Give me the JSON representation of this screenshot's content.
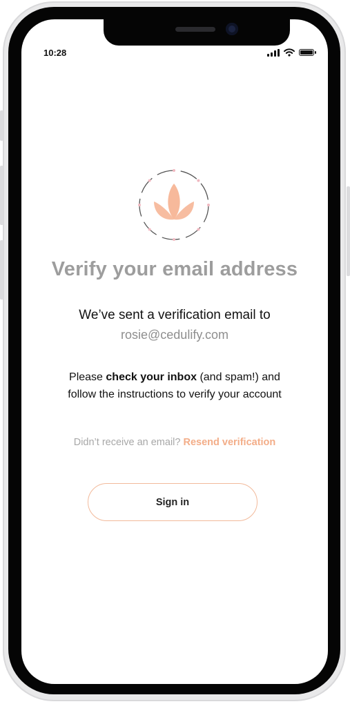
{
  "status_bar": {
    "time": "10:28"
  },
  "logo": {
    "icon": "lotus-icon",
    "accent": "#f6b190"
  },
  "content": {
    "title": "Verify your email address",
    "sent_line": "We’ve sent a verification email to",
    "email": "rosie@cedulify.com",
    "instructions": {
      "prefix": "Please ",
      "bold": "check your inbox",
      "suffix": " (and spam!) and",
      "line2": "follow the instructions to verify your account"
    },
    "resend": {
      "prompt": "Didn’t receive an email? ",
      "link": "Resend verification"
    },
    "signin_label": "Sign in"
  },
  "colors": {
    "title": "#9d9d9d",
    "accent": "#f3ad88",
    "button_border": "#f2b99a"
  }
}
